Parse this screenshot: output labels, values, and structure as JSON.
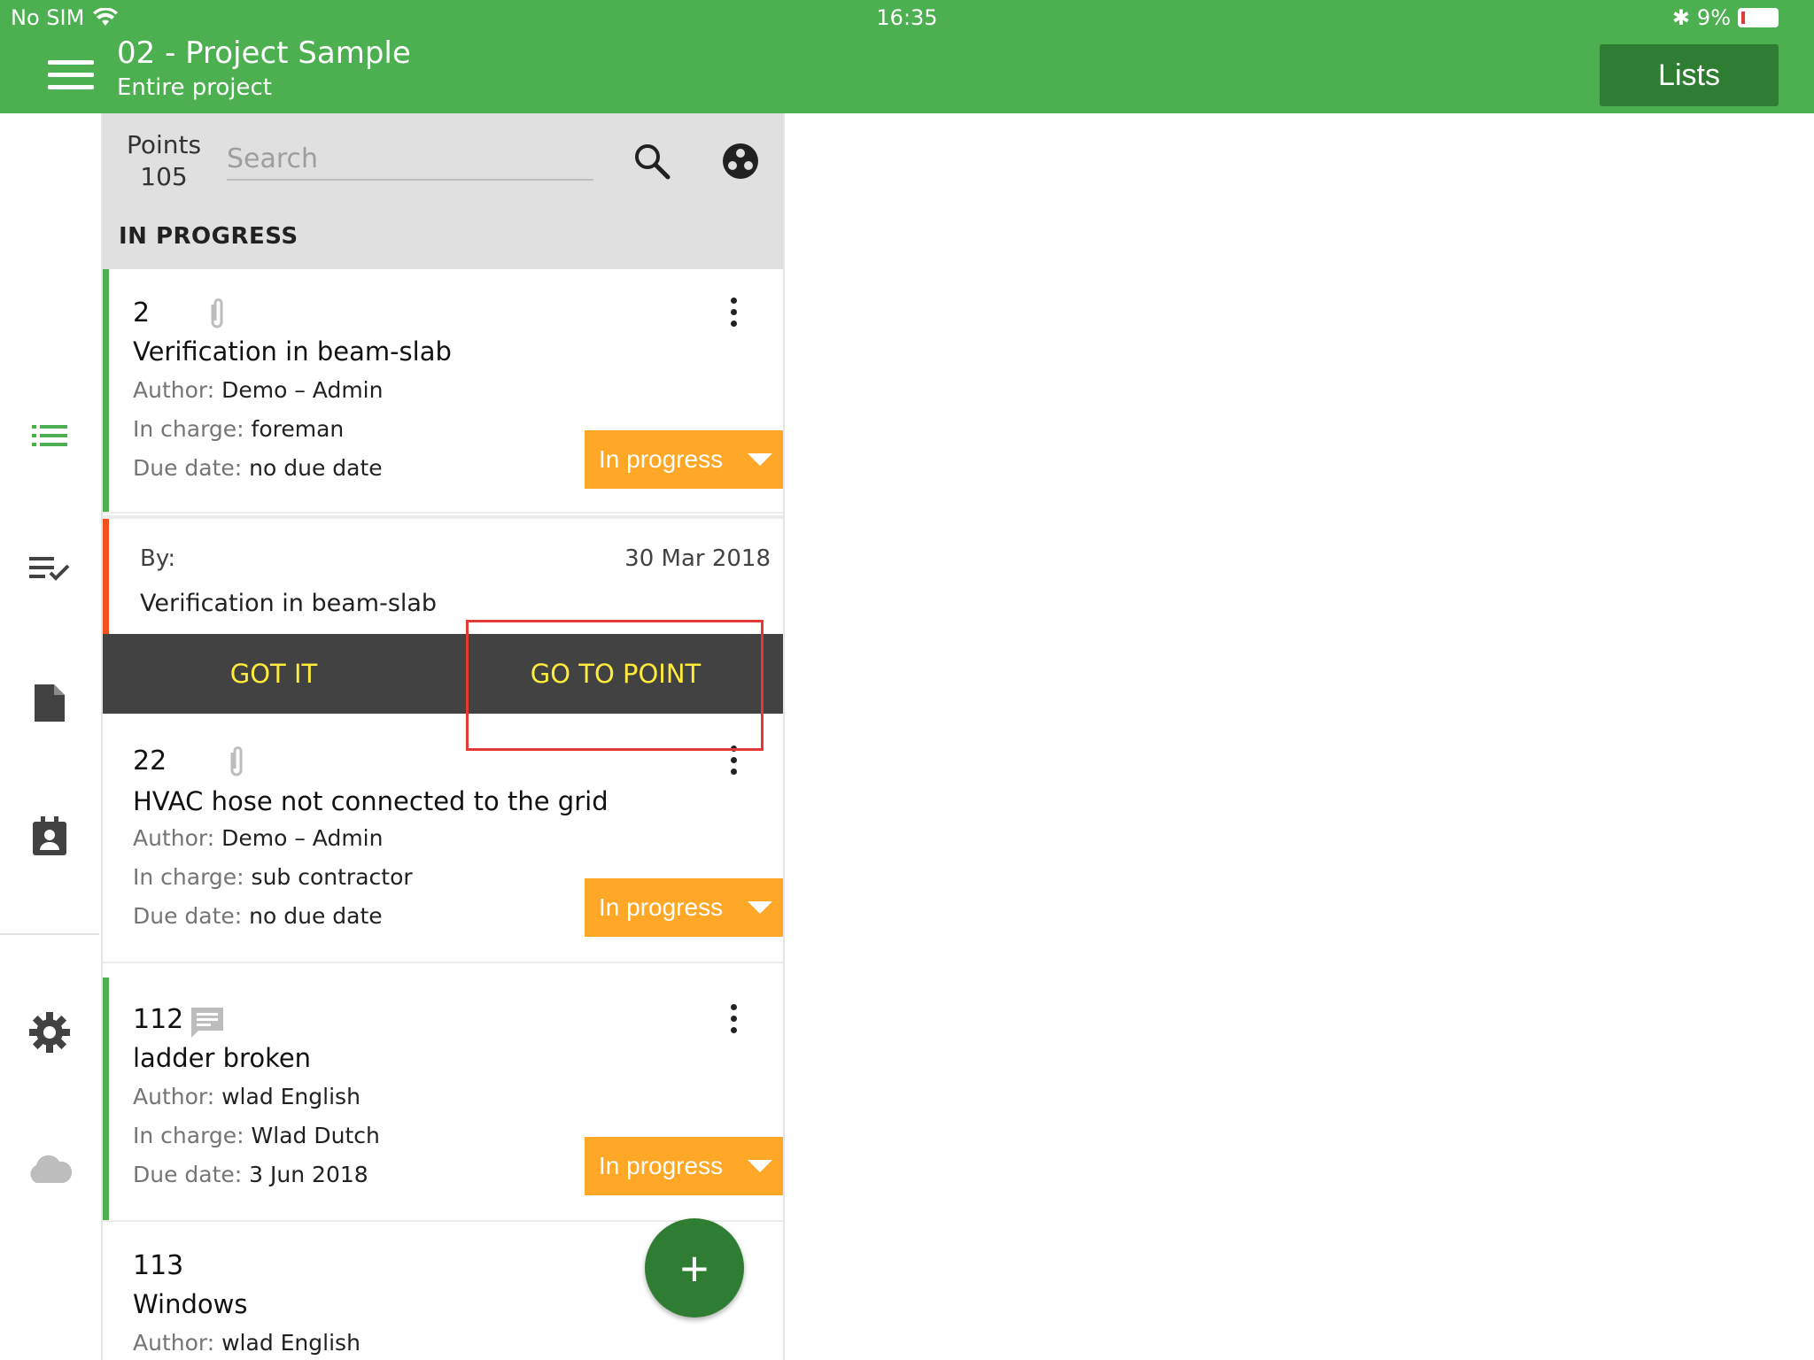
{
  "statusbar": {
    "carrier": "No SIM",
    "time": "16:35",
    "battery": "9%"
  },
  "appbar": {
    "title": "02 - Project Sample",
    "subtitle": "Entire project",
    "lists_label": "Lists"
  },
  "sidebar": {
    "items": [
      {
        "icon": "list-icon",
        "active": true
      },
      {
        "icon": "checklist-icon"
      },
      {
        "icon": "document-icon"
      },
      {
        "icon": "contact-icon"
      },
      {
        "icon": "gear-icon"
      },
      {
        "icon": "cloud-icon"
      }
    ],
    "accent": "#4caf50"
  },
  "header": {
    "points_label": "Points",
    "points_count": "105",
    "search_placeholder": "Search",
    "section": "IN PROGRESS"
  },
  "cards": [
    {
      "number": "2",
      "title": "Verification in beam-slab",
      "author_label": "Author:",
      "author": "Demo – Admin",
      "incharge_label": "In charge:",
      "incharge": "foreman",
      "due_label": "Due date:",
      "due": "no due date",
      "status": "In progress",
      "attachment": "paperclip-icon"
    },
    {
      "number": "22",
      "title": "HVAC hose not connected to the grid",
      "author_label": "Author:",
      "author": "Demo – Admin",
      "incharge_label": "In charge:",
      "incharge": "sub contractor",
      "due_label": "Due date:",
      "due": "no due date",
      "status": "In progress",
      "attachment": "paperclip-icon"
    },
    {
      "number": "112",
      "title": "ladder broken",
      "author_label": "Author:",
      "author": "wlad English",
      "incharge_label": "In charge:",
      "incharge": "Wlad Dutch",
      "due_label": "Due date:",
      "due": "3 Jun 2018",
      "status": "In progress",
      "attachment": "comment-icon"
    },
    {
      "number": "113",
      "title": "Windows",
      "author_label": "Author:",
      "author": "wlad English"
    }
  ],
  "notification": {
    "by_label": "By:",
    "date": "30 Mar 2018",
    "message": "Verification in beam-slab",
    "got_it": "GOT IT",
    "go_to_point": "GO TO POINT"
  },
  "fab": {
    "label": "+"
  },
  "colors": {
    "green": "#4caf50",
    "dark_green": "#2e7d32",
    "orange": "#ffa726",
    "notif_bar": "#f4511e",
    "action_text": "#ffeb3b",
    "highlight": "#e53935"
  }
}
